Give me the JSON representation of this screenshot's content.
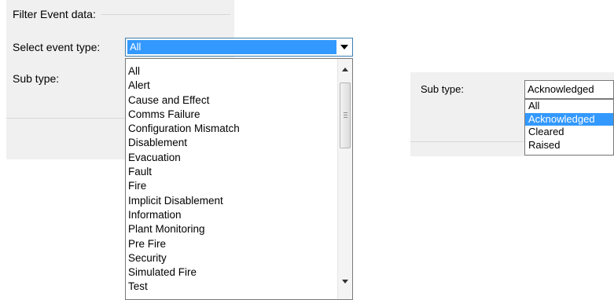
{
  "left": {
    "group_title": "Filter Event data:",
    "event_type_label": "Select event type:",
    "event_type_value": "All",
    "sub_type_label": "Sub type:",
    "event_types": [
      "All",
      "Alert",
      "Cause and Effect",
      "Comms Failure",
      "Configuration Mismatch",
      "Disablement",
      "Evacuation",
      "Fault",
      "Fire",
      "Implicit Disablement",
      "Information",
      "Plant Monitoring",
      "Pre Fire",
      "Security",
      "Simulated Fire",
      "Test"
    ]
  },
  "right": {
    "sub_type_label": "Sub type:",
    "sub_type_value": "Acknowledged",
    "sub_types": [
      "All",
      "Acknowledged",
      "Cleared",
      "Raised"
    ],
    "selected_sub_type": "Acknowledged"
  },
  "colors": {
    "panel_bg": "#f0f0f0",
    "selection": "#3399ff",
    "selection_text": "#ffffff",
    "focus_border": "#3c7fb1"
  }
}
